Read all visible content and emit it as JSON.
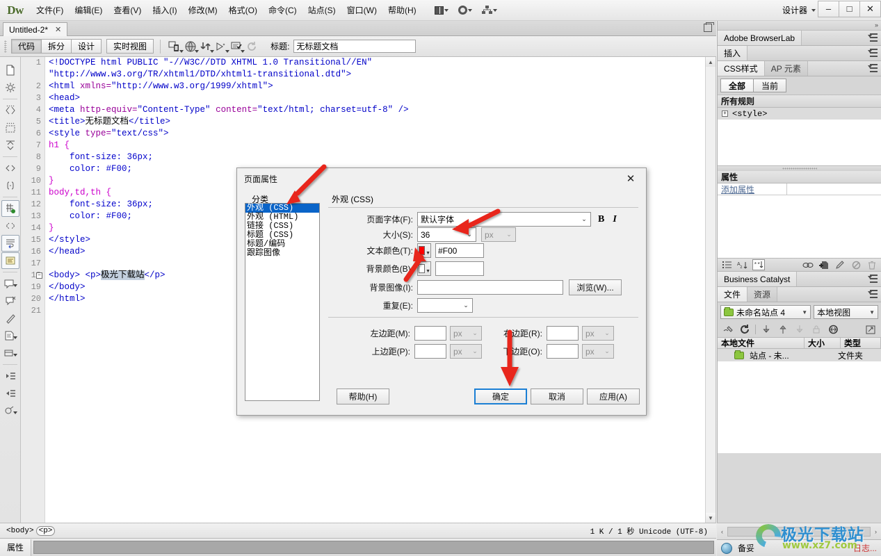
{
  "app": {
    "logo": "Dw",
    "workspace": "设计器",
    "menus": [
      "文件(F)",
      "编辑(E)",
      "查看(V)",
      "插入(I)",
      "修改(M)",
      "格式(O)",
      "命令(C)",
      "站点(S)",
      "窗口(W)",
      "帮助(H)"
    ],
    "window_controls": {
      "minimize": "–",
      "maximize": "□",
      "close": "✕"
    }
  },
  "tabstrip": {
    "tab_label": "Untitled-2*",
    "tab_close": "✕"
  },
  "doctoolbar": {
    "views": [
      "代码",
      "拆分",
      "设计",
      "实时视图"
    ],
    "active_view": "代码",
    "title_label": "标题:",
    "title_value": "无标题文档",
    "icons": [
      "file-management-icon",
      "preview-in-browser-icon",
      "file-transfer-icon",
      "live-code-icon",
      "visual-aids-icon",
      "refresh-icon"
    ]
  },
  "rail": {
    "icons": [
      "new-document-icon",
      "structure-icon",
      "code-collapse-icon",
      "select-parent-tag-icon",
      "expand-all-icon",
      "collapse-selection-icon",
      "code-braces-icon",
      "highlight-invalid-code-icon",
      "apply-comment-icon",
      "format-source-code-icon",
      "indent-code-icon",
      "line-numbers-icon",
      "word-wrap-icon",
      "syntax-color-icon",
      "recent-snippets-icon",
      "collapse-full-tag-icon",
      "refactor-icon",
      "attach-style-sheet-icon",
      "outdent-code-icon",
      "indent-code-2-icon",
      "color-picker-icon"
    ]
  },
  "code": {
    "lines": [
      {
        "n": "1",
        "parts": [
          {
            "t": "<!DOCTYPE html PUBLIC \"-//W3C//DTD XHTML 1.0 Transitional//EN\"",
            "c": "t-tag"
          }
        ]
      },
      {
        "n": "",
        "parts": [
          {
            "t": "\"http://www.w3.org/TR/xhtml1/DTD/xhtml1-transitional.dtd\">",
            "c": "t-str"
          }
        ]
      },
      {
        "n": "2",
        "parts": [
          {
            "t": "<html ",
            "c": "t-tag"
          },
          {
            "t": "xmlns=",
            "c": "t-attr"
          },
          {
            "t": "\"http://www.w3.org/1999/xhtml\"",
            "c": "t-str"
          },
          {
            "t": ">",
            "c": "t-tag"
          }
        ]
      },
      {
        "n": "3",
        "parts": [
          {
            "t": "<head>",
            "c": "t-tag"
          }
        ]
      },
      {
        "n": "4",
        "parts": [
          {
            "t": "<meta ",
            "c": "t-tag"
          },
          {
            "t": "http-equiv=",
            "c": "t-attr"
          },
          {
            "t": "\"Content-Type\"",
            "c": "t-str"
          },
          {
            "t": " ",
            "c": "t-plain"
          },
          {
            "t": "content=",
            "c": "t-attr"
          },
          {
            "t": "\"text/html; charset=utf-8\"",
            "c": "t-str"
          },
          {
            "t": " />",
            "c": "t-tag"
          }
        ]
      },
      {
        "n": "5",
        "parts": [
          {
            "t": "<title>",
            "c": "t-tag"
          },
          {
            "t": "无标题文档",
            "c": "t-plain"
          },
          {
            "t": "</title>",
            "c": "t-tag"
          }
        ]
      },
      {
        "n": "6",
        "parts": [
          {
            "t": "<style ",
            "c": "t-tag"
          },
          {
            "t": "type=",
            "c": "t-attr"
          },
          {
            "t": "\"text/css\"",
            "c": "t-str"
          },
          {
            "t": ">",
            "c": "t-tag"
          }
        ]
      },
      {
        "n": "7",
        "parts": [
          {
            "t": "h1 {",
            "c": "t-sel"
          }
        ]
      },
      {
        "n": "8",
        "parts": [
          {
            "t": "    font-size: 36px;",
            "c": "t-prop"
          }
        ]
      },
      {
        "n": "9",
        "parts": [
          {
            "t": "    color: #F00;",
            "c": "t-prop"
          }
        ]
      },
      {
        "n": "10",
        "parts": [
          {
            "t": "}",
            "c": "t-sel"
          }
        ]
      },
      {
        "n": "11",
        "parts": [
          {
            "t": "body,td,th {",
            "c": "t-sel"
          }
        ]
      },
      {
        "n": "12",
        "parts": [
          {
            "t": "    font-size: 36px;",
            "c": "t-prop"
          }
        ]
      },
      {
        "n": "13",
        "parts": [
          {
            "t": "    color: #F00;",
            "c": "t-prop"
          }
        ]
      },
      {
        "n": "14",
        "parts": [
          {
            "t": "}",
            "c": "t-sel"
          }
        ]
      },
      {
        "n": "15",
        "parts": [
          {
            "t": "</style>",
            "c": "t-tag"
          }
        ]
      },
      {
        "n": "16",
        "parts": [
          {
            "t": "</head>",
            "c": "t-tag"
          }
        ]
      },
      {
        "n": "17",
        "parts": [
          {
            "t": "",
            "c": "t-plain"
          }
        ]
      },
      {
        "n": "18",
        "fold": true,
        "parts": [
          {
            "t": "<body> <p>",
            "c": "t-tag"
          },
          {
            "t": "极光下载站",
            "c": "t-plain sel"
          },
          {
            "t": "</p>",
            "c": "t-tag"
          }
        ]
      },
      {
        "n": "19",
        "parts": [
          {
            "t": "</body>",
            "c": "t-tag"
          }
        ]
      },
      {
        "n": "20",
        "parts": [
          {
            "t": "</html>",
            "c": "t-tag"
          }
        ]
      },
      {
        "n": "21",
        "parts": [
          {
            "t": "",
            "c": "t-plain"
          }
        ]
      }
    ]
  },
  "statusbar": {
    "tags": [
      "<body>",
      "<p>"
    ],
    "info": "1 K / 1 秒  Unicode (UTF-8)",
    "prop_tab": "属性"
  },
  "dock": {
    "browserlab": {
      "title": "Adobe BrowserLab"
    },
    "insert": {
      "title": "插入"
    },
    "css": {
      "tabs": [
        "CSS样式",
        "AP 元素"
      ],
      "active_tab": "CSS样式",
      "segments": [
        "全部",
        "当前"
      ],
      "active_segment": "全部",
      "section_header": "所有规则",
      "rules": [
        "<style>"
      ]
    },
    "properties": {
      "header": "属性",
      "add_property": "添加属性",
      "toolbar_icons": [
        "category-view-icon",
        "az-sort-icon",
        "set-properties-icon",
        "attach-style-sheet-icon",
        "new-css-rule-icon",
        "edit-rule-icon",
        "disable-property-icon",
        "delete-property-icon"
      ]
    },
    "business_catalyst": {
      "title": "Business Catalyst"
    },
    "files": {
      "tabs": [
        "文件",
        "资源"
      ],
      "active_tab": "文件",
      "site_select": "未命名站点 4",
      "view_select": "本地视图",
      "toolbar_icons": [
        "connect-icon",
        "refresh-icon",
        "get-files-icon",
        "put-files-icon",
        "check-out-icon",
        "check-in-icon",
        "synchronize-icon",
        "expand-panel-icon"
      ],
      "columns": [
        "本地文件",
        "大小",
        "类型"
      ],
      "rows": [
        {
          "name": "站点 - 未...",
          "size": "",
          "type": "文件夹"
        }
      ]
    },
    "bottom": {
      "label": "备妥",
      "log": "日志..."
    },
    "scroll": {
      "left_arrow": "‹",
      "right_arrow": "›"
    }
  },
  "dialog": {
    "title": "页面属性",
    "close": "✕",
    "category_label": "分类",
    "categories": [
      "外观 (CSS)",
      "外观 (HTML)",
      "链接 (CSS)",
      "标题 (CSS)",
      "标题/编码",
      "跟踪图像"
    ],
    "selected_category": "外观 (CSS)",
    "group_title": "外观 (CSS)",
    "fields": {
      "page_font_label": "页面字体(F):",
      "page_font_value": "默认字体",
      "bold_glyph": "B",
      "italic_glyph": "I",
      "size_label": "大小(S):",
      "size_value": "36",
      "size_unit": "px",
      "text_color_label": "文本颜色(T):",
      "text_color_value": "#F00",
      "text_color_hex": "#FF0000",
      "bg_color_label": "背景颜色(B):",
      "bg_color_value": "",
      "bg_image_label": "背景图像(I):",
      "bg_image_value": "",
      "browse_button": "浏览(W)...",
      "repeat_label": "重复(E):",
      "repeat_value": "",
      "margin_left_label": "左边距(M):",
      "margin_left_value": "",
      "margin_left_unit": "px",
      "margin_right_label": "右边距(R):",
      "margin_right_value": "",
      "margin_right_unit": "px",
      "margin_top_label": "上边距(P):",
      "margin_top_value": "",
      "margin_top_unit": "px",
      "margin_bottom_label": "下边距(O):",
      "margin_bottom_value": "",
      "margin_bottom_unit": "px"
    },
    "buttons": {
      "help": "帮助(H)",
      "ok": "确定",
      "cancel": "取消",
      "apply": "应用(A)"
    }
  },
  "watermark": {
    "big": "极光下载站",
    "small": "www.xz7.com"
  },
  "colors": {
    "accent_blue": "#0a64c8",
    "ok_border": "#1b7fd4",
    "arrow_red": "#e8251b",
    "text_red": "#FF0000"
  }
}
